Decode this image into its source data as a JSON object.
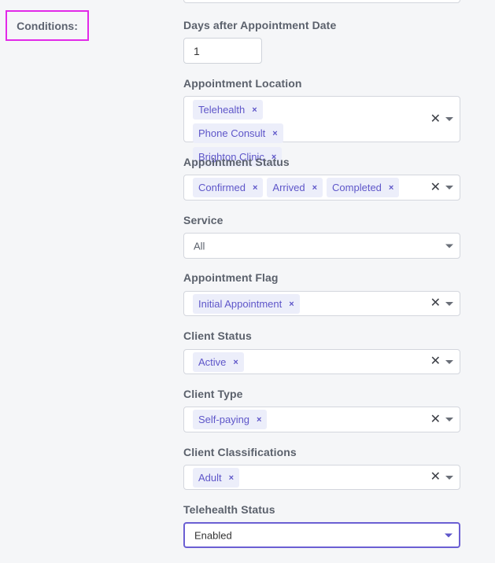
{
  "section_label": "Conditions:",
  "days_after": {
    "label": "Days after Appointment Date",
    "value": "1"
  },
  "appointment_location": {
    "label": "Appointment Location",
    "tags": [
      "Telehealth",
      "Phone Consult",
      "Brighton Clinic"
    ]
  },
  "appointment_status": {
    "label": "Appointment Status",
    "tags": [
      "Confirmed",
      "Arrived",
      "Completed"
    ]
  },
  "service": {
    "label": "Service",
    "value": "All"
  },
  "appointment_flag": {
    "label": "Appointment Flag",
    "tags": [
      "Initial Appointment"
    ]
  },
  "client_status": {
    "label": "Client Status",
    "tags": [
      "Active"
    ]
  },
  "client_type": {
    "label": "Client Type",
    "tags": [
      "Self-paying"
    ]
  },
  "client_classifications": {
    "label": "Client Classifications",
    "tags": [
      "Adult"
    ]
  },
  "telehealth_status": {
    "label": "Telehealth Status",
    "value": "Enabled"
  },
  "icons": {
    "tag_remove": "×",
    "clear_all": "✕",
    "dropdown": "chevron-down"
  },
  "colors": {
    "accent": "#5e56c9",
    "highlight_border": "#e229e8",
    "tag_bg": "#eceefa"
  }
}
